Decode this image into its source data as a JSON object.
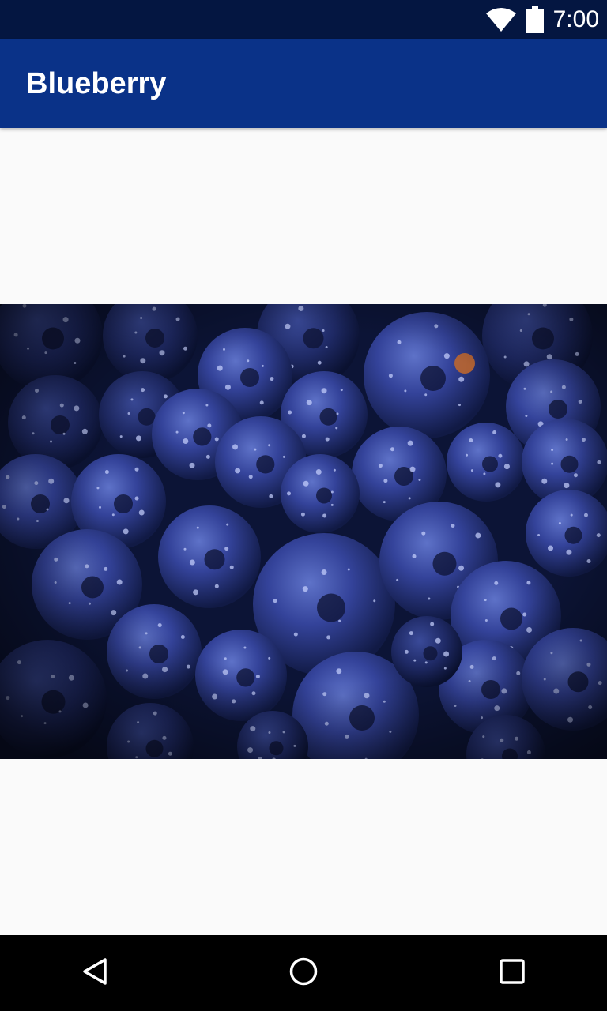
{
  "status_bar": {
    "time": "7:00",
    "icons": [
      "wifi-icon",
      "battery-icon"
    ]
  },
  "app_bar": {
    "title": "Blueberry"
  },
  "content": {
    "image": {
      "subject": "blueberries-photo"
    }
  },
  "nav_bar": {
    "buttons": [
      "back-icon",
      "home-icon",
      "recents-icon"
    ]
  },
  "colors": {
    "status_bar": "#041641",
    "app_bar": "#0a3288",
    "background": "#fafafa",
    "nav_bar": "#000000"
  }
}
